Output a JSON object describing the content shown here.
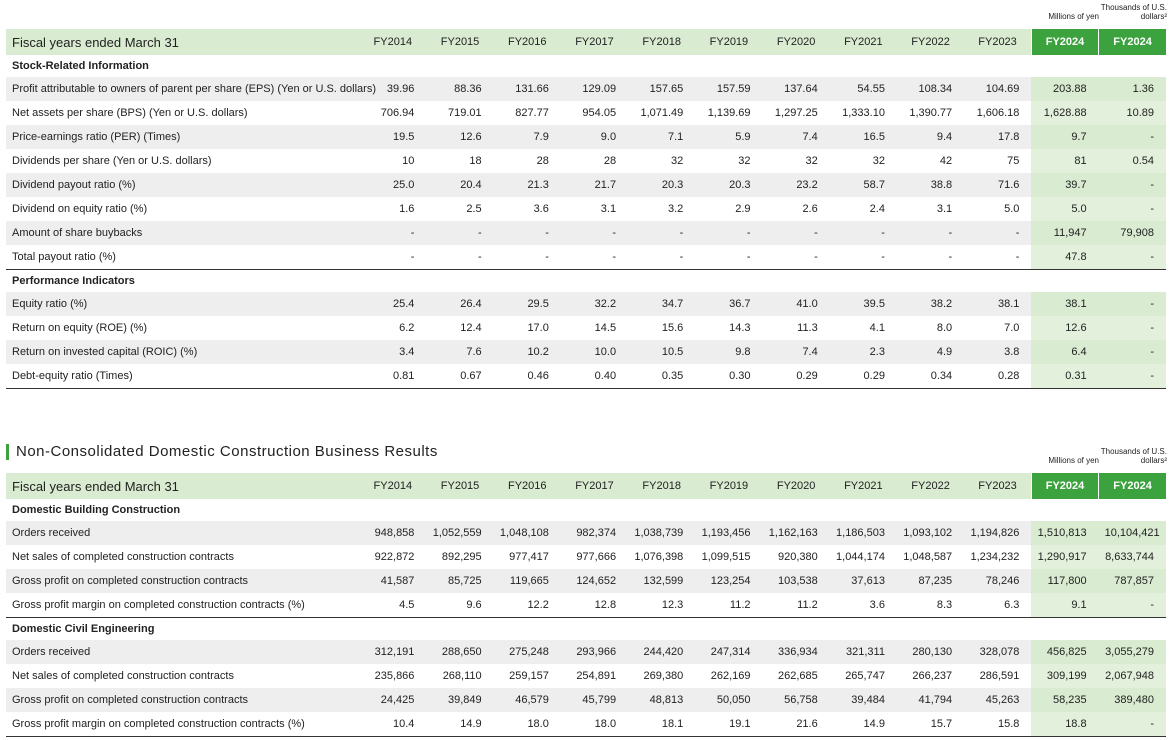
{
  "section1": {
    "unit_left": "Millions of yen",
    "unit_right": "Thousands of U.S. dollars²",
    "header_label": "Fiscal years ended March 31",
    "years": [
      "FY2014",
      "FY2015",
      "FY2016",
      "FY2017",
      "FY2018",
      "FY2019",
      "FY2020",
      "FY2021",
      "FY2022",
      "FY2023",
      "FY2024",
      "FY2024"
    ],
    "groups": [
      {
        "title": "Stock-Related Information",
        "rows": [
          {
            "label": "Profit attributable to owners of parent per share (EPS) (Yen or U.S. dollars)",
            "values": [
              "39.96",
              "88.36",
              "131.66",
              "129.09",
              "157.65",
              "157.59",
              "137.64",
              "54.55",
              "108.34",
              "104.69",
              "203.88",
              "1.36"
            ]
          },
          {
            "label": "Net assets per share (BPS) (Yen or U.S. dollars)",
            "values": [
              "706.94",
              "719.01",
              "827.77",
              "954.05",
              "1,071.49",
              "1,139.69",
              "1,297.25",
              "1,333.10",
              "1,390.77",
              "1,606.18",
              "1,628.88",
              "10.89"
            ]
          },
          {
            "label": "Price-earnings ratio (PER) (Times)",
            "values": [
              "19.5",
              "12.6",
              "7.9",
              "9.0",
              "7.1",
              "5.9",
              "7.4",
              "16.5",
              "9.4",
              "17.8",
              "9.7",
              "-"
            ]
          },
          {
            "label": "Dividends per share (Yen or U.S. dollars)",
            "values": [
              "10",
              "18",
              "28",
              "28",
              "32",
              "32",
              "32",
              "32",
              "42",
              "75",
              "81",
              "0.54"
            ]
          },
          {
            "label": "Dividend payout ratio (%)",
            "values": [
              "25.0",
              "20.4",
              "21.3",
              "21.7",
              "20.3",
              "20.3",
              "23.2",
              "58.7",
              "38.8",
              "71.6",
              "39.7",
              "-"
            ]
          },
          {
            "label": "Dividend on equity ratio (%)",
            "values": [
              "1.6",
              "2.5",
              "3.6",
              "3.1",
              "3.2",
              "2.9",
              "2.6",
              "2.4",
              "3.1",
              "5.0",
              "5.0",
              "-"
            ]
          },
          {
            "label": "Amount of share buybacks",
            "values": [
              "-",
              "-",
              "-",
              "-",
              "-",
              "-",
              "-",
              "-",
              "-",
              "-",
              "11,947",
              "79,908"
            ]
          },
          {
            "label": "Total payout ratio (%)",
            "values": [
              "-",
              "-",
              "-",
              "-",
              "-",
              "-",
              "-",
              "-",
              "-",
              "-",
              "47.8",
              "-"
            ]
          }
        ]
      },
      {
        "title": "Performance Indicators",
        "rows": [
          {
            "label": "Equity ratio (%)",
            "values": [
              "25.4",
              "26.4",
              "29.5",
              "32.2",
              "34.7",
              "36.7",
              "41.0",
              "39.5",
              "38.2",
              "38.1",
              "38.1",
              "-"
            ]
          },
          {
            "label": "Return on equity (ROE) (%)",
            "values": [
              "6.2",
              "12.4",
              "17.0",
              "14.5",
              "15.6",
              "14.3",
              "11.3",
              "4.1",
              "8.0",
              "7.0",
              "12.6",
              "-"
            ]
          },
          {
            "label": "Return on invested capital (ROIC) (%)",
            "values": [
              "3.4",
              "7.6",
              "10.2",
              "10.0",
              "10.5",
              "9.8",
              "7.4",
              "2.3",
              "4.9",
              "3.8",
              "6.4",
              "-"
            ]
          },
          {
            "label": "Debt-equity ratio (Times)",
            "values": [
              "0.81",
              "0.67",
              "0.46",
              "0.40",
              "0.35",
              "0.30",
              "0.29",
              "0.29",
              "0.34",
              "0.28",
              "0.31",
              "-"
            ]
          }
        ]
      }
    ]
  },
  "section2": {
    "title": "Non-Consolidated Domestic Construction Business Results",
    "unit_left": "Millions of yen",
    "unit_right": "Thousands of U.S. dollars²",
    "header_label": "Fiscal years ended March 31",
    "years": [
      "FY2014",
      "FY2015",
      "FY2016",
      "FY2017",
      "FY2018",
      "FY2019",
      "FY2020",
      "FY2021",
      "FY2022",
      "FY2023",
      "FY2024",
      "FY2024"
    ],
    "groups": [
      {
        "title": "Domestic Building Construction",
        "rows": [
          {
            "label": "Orders received",
            "values": [
              "948,858",
              "1,052,559",
              "1,048,108",
              "982,374",
              "1,038,739",
              "1,193,456",
              "1,162,163",
              "1,186,503",
              "1,093,102",
              "1,194,826",
              "1,510,813",
              "10,104,421"
            ]
          },
          {
            "label": "Net sales of completed construction contracts",
            "values": [
              "922,872",
              "892,295",
              "977,417",
              "977,666",
              "1,076,398",
              "1,099,515",
              "920,380",
              "1,044,174",
              "1,048,587",
              "1,234,232",
              "1,290,917",
              "8,633,744"
            ]
          },
          {
            "label": "Gross profit on completed construction contracts",
            "values": [
              "41,587",
              "85,725",
              "119,665",
              "124,652",
              "132,599",
              "123,254",
              "103,538",
              "37,613",
              "87,235",
              "78,246",
              "117,800",
              "787,857"
            ]
          },
          {
            "label": "Gross profit margin on completed construction contracts (%)",
            "values": [
              "4.5",
              "9.6",
              "12.2",
              "12.8",
              "12.3",
              "11.2",
              "11.2",
              "3.6",
              "8.3",
              "6.3",
              "9.1",
              "-"
            ]
          }
        ]
      },
      {
        "title": "Domestic Civil Engineering",
        "rows": [
          {
            "label": "Orders received",
            "values": [
              "312,191",
              "288,650",
              "275,248",
              "293,966",
              "244,420",
              "247,314",
              "336,934",
              "321,311",
              "280,130",
              "328,078",
              "456,825",
              "3,055,279"
            ]
          },
          {
            "label": "Net sales of completed construction contracts",
            "values": [
              "235,866",
              "268,110",
              "259,157",
              "254,891",
              "269,380",
              "262,169",
              "262,685",
              "265,747",
              "266,237",
              "286,591",
              "309,199",
              "2,067,948"
            ]
          },
          {
            "label": "Gross profit on completed construction contracts",
            "values": [
              "24,425",
              "39,849",
              "46,579",
              "45,799",
              "48,813",
              "50,050",
              "56,758",
              "39,484",
              "41,794",
              "45,263",
              "58,235",
              "389,480"
            ]
          },
          {
            "label": "Gross profit margin on completed construction contracts (%)",
            "values": [
              "10.4",
              "14.9",
              "18.0",
              "18.0",
              "18.1",
              "19.1",
              "21.6",
              "14.9",
              "15.7",
              "15.8",
              "18.8",
              "-"
            ]
          }
        ]
      }
    ]
  },
  "colors": {
    "accent": "#3ba23e",
    "header_bg": "#d9ebd0",
    "row_alt": "#eeeeee",
    "highlight_col": "#e3f0dc"
  }
}
